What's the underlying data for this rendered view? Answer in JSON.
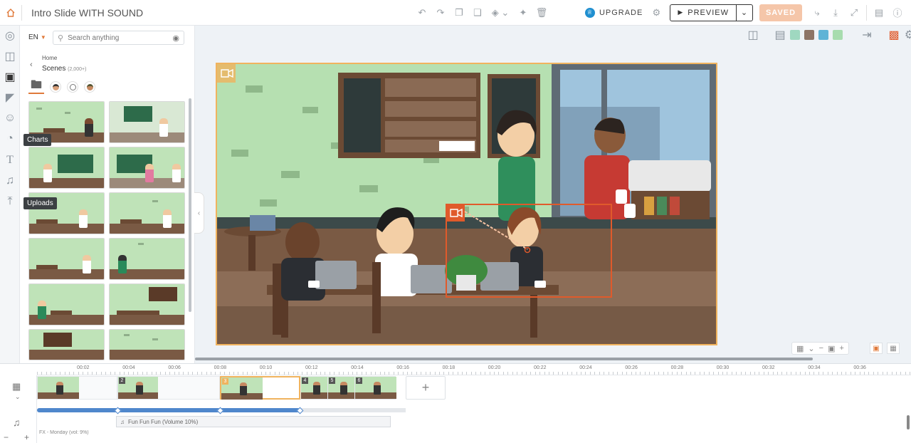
{
  "project": {
    "title": "Intro Slide WITH SOUND"
  },
  "topbar": {
    "upgrade_label": "UPGRADE",
    "preview_label": "PREVIEW",
    "saved_label": "SAVED"
  },
  "rail": {
    "tooltips": {
      "charts": "Charts",
      "uploads": "Uploads"
    }
  },
  "panel": {
    "language": "EN",
    "search_placeholder": "Search anything",
    "breadcrumb_home": "Home",
    "breadcrumb_current": "Scenes",
    "breadcrumb_count": "(2,000+)"
  },
  "colors": {
    "accent": "#e07a3b",
    "selection": "#f0b35e",
    "camera_frame": "#e05a2b",
    "timeline_track": "#4f87cc",
    "palette": [
      "#9fd8c0",
      "#8d7466",
      "#5fb3d6",
      "#a7dcae"
    ]
  },
  "timeline": {
    "ticks": [
      "00:02",
      "00:04",
      "00:06",
      "00:08",
      "00:10",
      "00:12",
      "00:14",
      "00:16",
      "00:18",
      "00:20",
      "00:22",
      "00:24",
      "00:26",
      "00:28",
      "00:30",
      "00:32",
      "00:34",
      "00:36"
    ],
    "scenes": [
      {
        "num": "",
        "selected": false
      },
      {
        "num": "2",
        "selected": false
      },
      {
        "num": "3",
        "selected": true
      },
      {
        "num": "4",
        "selected": false
      },
      {
        "num": "5",
        "selected": false
      },
      {
        "num": "6",
        "selected": false
      }
    ],
    "audio_track": "Fun Fun Fun (Volume 10%)",
    "sfx_track": "FX - Monday (vol: 9%)"
  }
}
